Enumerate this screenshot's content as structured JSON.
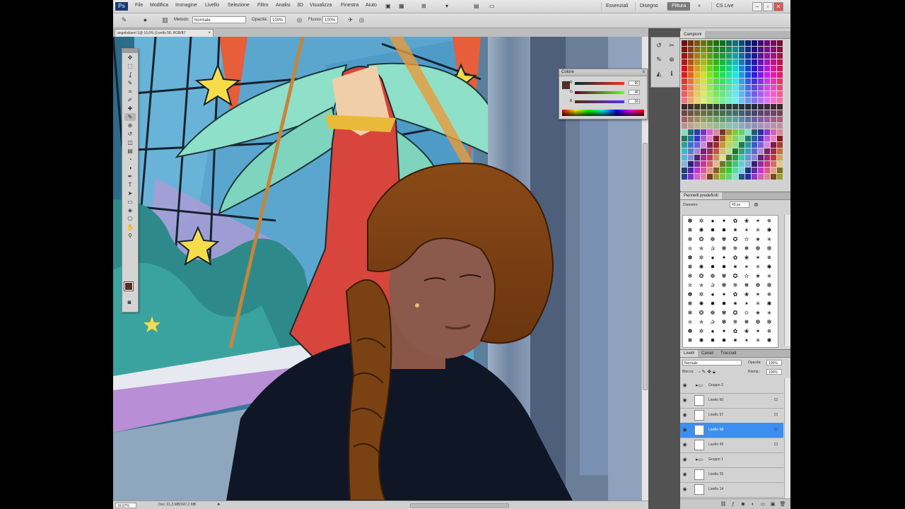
{
  "menubar": {
    "logo": "Ps",
    "items": [
      "File",
      "Modifica",
      "Immagine",
      "Livello",
      "Selezione",
      "Filtro",
      "Analisi",
      "3D",
      "Visualizza",
      "Finestra",
      "Aiuto"
    ],
    "workspaces": [
      "Essenziali",
      "Disegno",
      "Pittura"
    ],
    "active_workspace": "Pittura",
    "live_label": "CS Live",
    "win_controls": [
      "–",
      "▫",
      "✕"
    ]
  },
  "options": {
    "mode_label": "Metodo:",
    "mode_value": "Normale",
    "opacity_label": "Opacità:",
    "opacity_value": "100%",
    "flow_label": "Flusso:",
    "flow_value": "100%"
  },
  "document": {
    "tab_title": "angelo&arel 1@ 16,6% (Livello 58, RGB/8)*",
    "zoom": "16,67%",
    "doc_info": "Doc: 91,3 MB/347,2 MB"
  },
  "color_panel": {
    "title": "Colore",
    "channels": [
      {
        "letter": "R",
        "value": "90"
      },
      {
        "letter": "G",
        "value": "46"
      },
      {
        "letter": "B",
        "value": "36"
      }
    ],
    "fg_color": "#5a2e24"
  },
  "swatches_panel": {
    "title": "Campioni"
  },
  "brush_panel": {
    "title": "Pennelli predefiniti",
    "size_label": "Diametro:",
    "size_value": "40 px"
  },
  "layers_panel": {
    "tabs": [
      "Livelli",
      "Canali",
      "Tracciati"
    ],
    "blend_mode": "Normale",
    "opacity_label": "Opacità:",
    "opacity_value": "100%",
    "lock_label": "Blocca:",
    "fill_label": "Riemp.:",
    "fill_value": "100%",
    "layers": [
      {
        "name": "Gruppo 2",
        "type": "group"
      },
      {
        "name": "Livello 60",
        "type": "layer"
      },
      {
        "name": "Livello 57",
        "type": "layer"
      },
      {
        "name": "Livello 58",
        "type": "layer",
        "selected": true
      },
      {
        "name": "Livello 49",
        "type": "layer"
      },
      {
        "name": "Gruppo 1",
        "type": "group"
      },
      {
        "name": "Livello 25",
        "type": "layer"
      },
      {
        "name": "Livello 14",
        "type": "layer"
      }
    ]
  },
  "toolbox": {
    "tools": [
      "move-tool",
      "marquee-tool",
      "lasso-tool",
      "quick-select-tool",
      "crop-tool",
      "eyedropper-tool",
      "healing-tool",
      "brush-tool",
      "clone-tool",
      "history-brush-tool",
      "eraser-tool",
      "gradient-tool",
      "blur-tool",
      "dodge-tool",
      "pen-tool",
      "type-tool",
      "path-select-tool",
      "shape-tool",
      "3d-tool",
      "3d-camera-tool",
      "hand-tool",
      "zoom-tool"
    ],
    "glyphs": [
      "✥",
      "⬚",
      "ʆ",
      "✎",
      "⌗",
      "✐",
      "✚",
      "✎",
      "⊕",
      "↺",
      "◫",
      "▤",
      "◔",
      "◑",
      "✒",
      "T",
      "➤",
      "▭",
      "◈",
      "⎔",
      "✋",
      "⚲"
    ],
    "fg": "#5a2e24",
    "bg": "#ffffff"
  }
}
